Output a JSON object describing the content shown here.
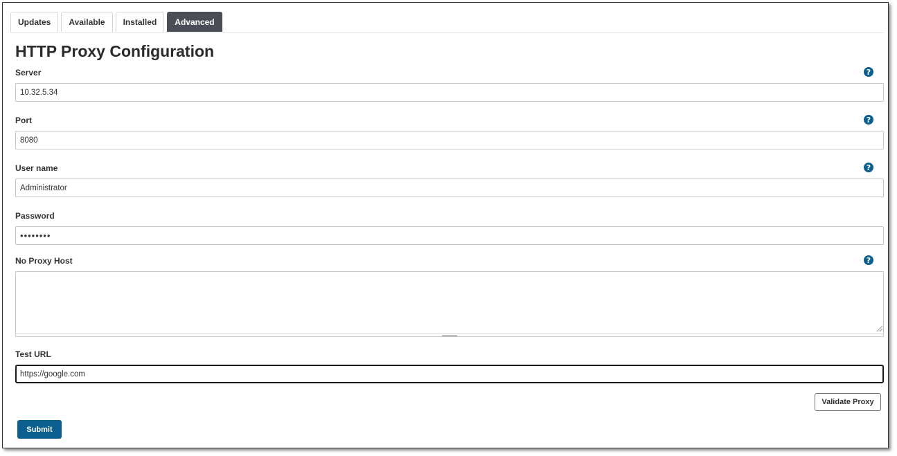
{
  "tabs": [
    {
      "label": "Updates",
      "active": false
    },
    {
      "label": "Available",
      "active": false
    },
    {
      "label": "Installed",
      "active": false
    },
    {
      "label": "Advanced",
      "active": true
    }
  ],
  "page_title": "HTTP Proxy Configuration",
  "fields": {
    "server": {
      "label": "Server",
      "value": "10.32.5.34"
    },
    "port": {
      "label": "Port",
      "value": "8080"
    },
    "username": {
      "label": "User name",
      "value": "Administrator"
    },
    "password": {
      "label": "Password",
      "value": "••••••••"
    },
    "no_proxy_host": {
      "label": "No Proxy Host",
      "value": ""
    },
    "test_url": {
      "label": "Test URL",
      "value": "https://google.com"
    }
  },
  "help_glyph": "?",
  "buttons": {
    "validate_proxy": "Validate Proxy",
    "submit": "Submit"
  },
  "colors": {
    "active_tab": "#4a4f57",
    "primary": "#0b5f8f"
  },
  "icons": {
    "help": "help-icon"
  }
}
